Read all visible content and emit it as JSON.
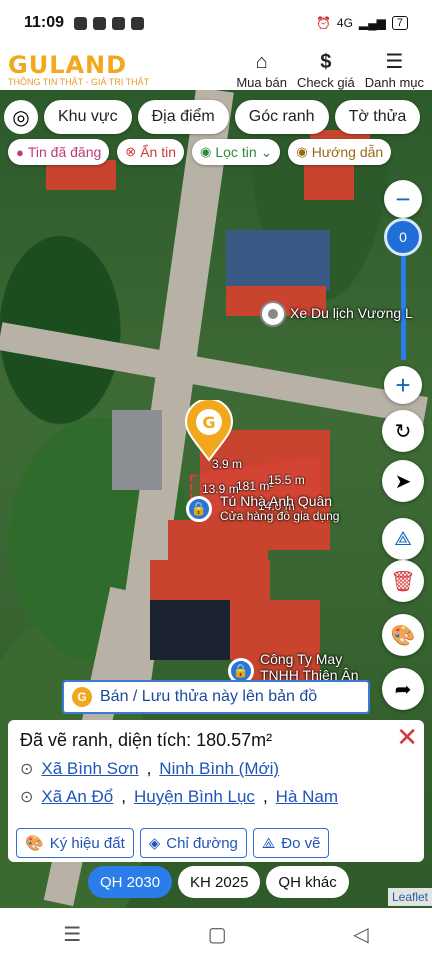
{
  "status_bar": {
    "time": "11:09",
    "battery": "7",
    "net": "4G"
  },
  "header": {
    "logo": "GULAND",
    "logo_sub": "THÔNG TIN THẬT - GIÁ TRỊ THẬT",
    "nav": [
      {
        "label": "Mua bán",
        "icon": "house-icon"
      },
      {
        "label": "Check giá",
        "icon": "dollar-icon"
      },
      {
        "label": "Danh mục",
        "icon": "menu-icon"
      }
    ]
  },
  "filters": {
    "pills": [
      "Khu vực",
      "Địa điểm",
      "Góc ranh",
      "Tờ thửa"
    ],
    "chips": [
      {
        "label": "Tin đã đăng",
        "icon": "post-icon"
      },
      {
        "label": "Ẩn tin",
        "icon": "hide-icon"
      },
      {
        "label": "Lọc tin",
        "icon": "filter-pin-icon"
      },
      {
        "label": "Hướng dẫn",
        "icon": "guide-icon"
      }
    ]
  },
  "zoom": {
    "level": "0"
  },
  "map": {
    "labels": [
      "Xe Du lịch Vương L",
      "Tú Nhà Anh Quân",
      "Cửa hàng đồ gia dụng",
      "Công Ty May",
      "TNHH Thiên Ân"
    ],
    "dimensions": [
      "3.9 m",
      "181 m²",
      "15.5 m",
      "13.9 m",
      "14.0 m"
    ]
  },
  "banner": {
    "label": "Bán / Lưu thửa này lên bản đồ"
  },
  "panel": {
    "title": "Đã vẽ ranh, diện tích: 180.57m²",
    "addr1": {
      "commune": "Xã Bình Sơn",
      "province": "Ninh Bình (Mới)"
    },
    "addr2": {
      "commune": "Xã An Đổ",
      "district": "Huyện Bình Lục",
      "province": "Hà Nam"
    },
    "actions": [
      "Ký hiệu đất",
      "Chỉ đường",
      "Đo vẽ"
    ]
  },
  "tabs": [
    "QH 2030",
    "KH 2025",
    "QH khác"
  ],
  "attribution": "Leaflet"
}
